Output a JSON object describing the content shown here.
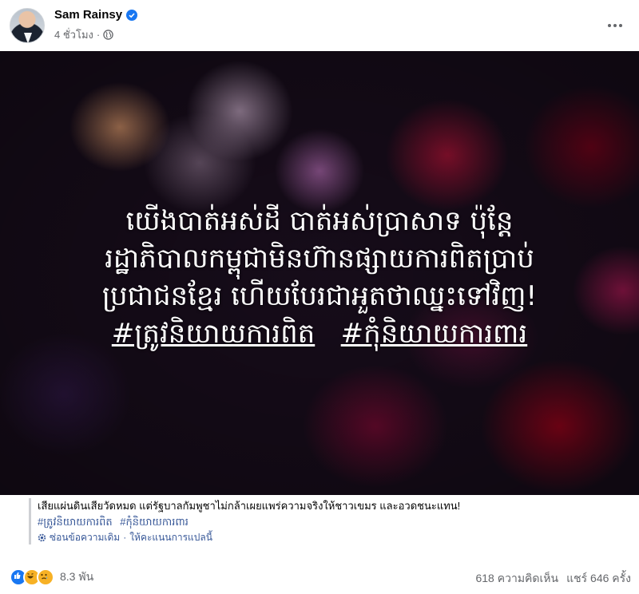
{
  "post": {
    "author": "Sam Rainsy",
    "time": "4 ชั่วโมง",
    "dot": "·"
  },
  "image_text": {
    "line1": "យើងបាត់អស់ដី បាត់អស់ប្រាសាទ ប៉ុន្តែ",
    "line2": "រដ្ឋាភិបាលកម្ពុជាមិនហ៊ានផ្សាយការពិតប្រាប់",
    "line3": "ប្រជាជនខ្មែរ ហើយបែរជាអួតថាឈ្នះទៅវិញ!",
    "tag1": "#ត្រូវនិយាយការពិត",
    "tag2": "#កុំនិយាយការពារ"
  },
  "caption": {
    "text": "เสียแผ่นดินเสียวัดหมด แต่รัฐบาลกัมพูชาไม่กล้าเผยแพร่ความจริงให้ชาวเขมร และอวดชนะแทน!",
    "tags": [
      "#ត្រូវនិយាយការពិត",
      "#កុំនិយាយការពារ"
    ],
    "hide_original": "ซ่อนข้อความเดิม",
    "separator": "·",
    "rate_translation": "ให้คะแนนการแปลนี้"
  },
  "footer": {
    "reaction_count": "8.3 พัน",
    "comments": "618 ความคิดเห็น",
    "shares": "แชร์ 646 ครั้ง"
  },
  "icons": {
    "verified": "verified-badge-icon",
    "globe": "globe-icon",
    "more": "more-options-icon",
    "gear": "gear-icon"
  },
  "colors": {
    "link": "#385898",
    "verified": "#1877f2",
    "muted": "#65676b"
  }
}
